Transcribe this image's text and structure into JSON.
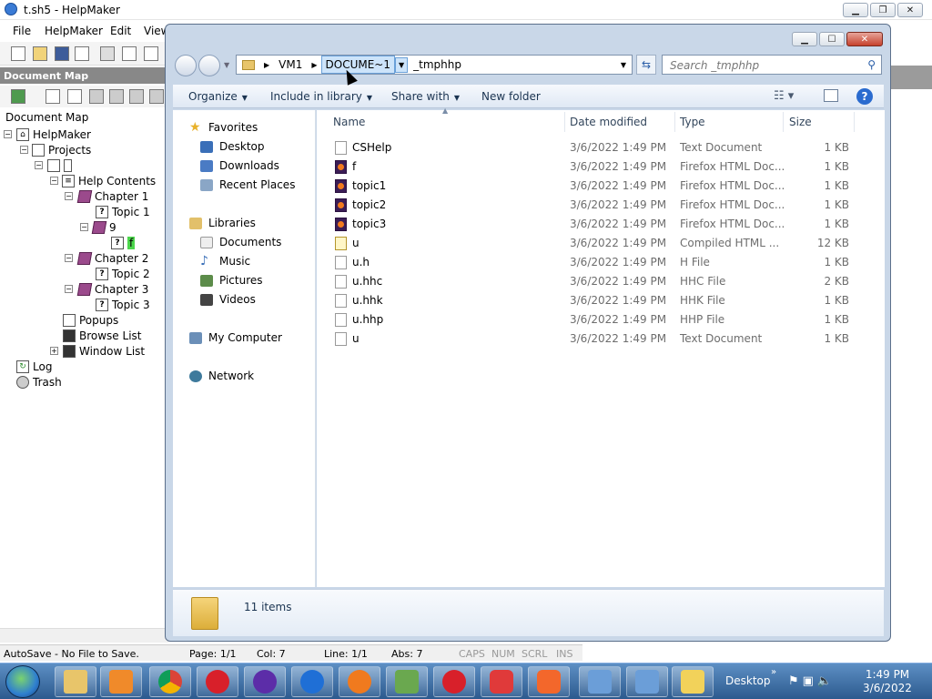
{
  "helpmaker": {
    "title": "t.sh5 - HelpMaker",
    "menu": [
      "File",
      "HelpMaker",
      "Edit",
      "View"
    ],
    "document_map_header": "Document Map",
    "document_map_label": "Document Map",
    "tree": {
      "root": "HelpMaker",
      "projects": "Projects",
      "help_contents": "Help Contents",
      "chapter1": "Chapter 1",
      "topic1": "Topic 1",
      "node9": "9",
      "node_f": "f",
      "chapter2": "Chapter 2",
      "topic2": "Topic 2",
      "chapter3": "Chapter 3",
      "topic3": "Topic 3",
      "popups": "Popups",
      "browse_list": "Browse List",
      "window_list": "Window List",
      "log": "Log",
      "trash": "Trash"
    },
    "status": {
      "autosave": "AutoSave - No File to Save.",
      "page": "Page: 1/1",
      "col": "Col: 7",
      "line": "Line: 1/1",
      "abs": "Abs: 7",
      "caps": "CAPS",
      "num": "NUM",
      "scrl": "SCRL",
      "ins": "INS"
    }
  },
  "explorer": {
    "address": {
      "crumbs": [
        "VM1",
        "DOCUME~1",
        "_tmphhp"
      ],
      "selected_crumb": "DOCUME~1"
    },
    "search_placeholder": "Search _tmphhp",
    "commands": {
      "organize": "Organize",
      "include_in_library": "Include in library",
      "share_with": "Share with",
      "new_folder": "New folder"
    },
    "nav": {
      "favorites": "Favorites",
      "desktop": "Desktop",
      "downloads": "Downloads",
      "recent_places": "Recent Places",
      "libraries": "Libraries",
      "documents": "Documents",
      "music": "Music",
      "pictures": "Pictures",
      "videos": "Videos",
      "my_computer": "My Computer",
      "network": "Network"
    },
    "columns": {
      "name": "Name",
      "date": "Date modified",
      "type": "Type",
      "size": "Size"
    },
    "files": [
      {
        "name": "CSHelp",
        "date": "3/6/2022 1:49 PM",
        "type": "Text Document",
        "size": "1 KB",
        "icon": "text"
      },
      {
        "name": "f",
        "date": "3/6/2022 1:49 PM",
        "type": "Firefox HTML Doc...",
        "size": "1 KB",
        "icon": "firefox"
      },
      {
        "name": "topic1",
        "date": "3/6/2022 1:49 PM",
        "type": "Firefox HTML Doc...",
        "size": "1 KB",
        "icon": "firefox"
      },
      {
        "name": "topic2",
        "date": "3/6/2022 1:49 PM",
        "type": "Firefox HTML Doc...",
        "size": "1 KB",
        "icon": "firefox"
      },
      {
        "name": "topic3",
        "date": "3/6/2022 1:49 PM",
        "type": "Firefox HTML Doc...",
        "size": "1 KB",
        "icon": "firefox"
      },
      {
        "name": "u",
        "date": "3/6/2022 1:49 PM",
        "type": "Compiled HTML ...",
        "size": "12 KB",
        "icon": "chm"
      },
      {
        "name": "u.h",
        "date": "3/6/2022 1:49 PM",
        "type": "H File",
        "size": "1 KB",
        "icon": "text"
      },
      {
        "name": "u.hhc",
        "date": "3/6/2022 1:49 PM",
        "type": "HHC File",
        "size": "2 KB",
        "icon": "text"
      },
      {
        "name": "u.hhk",
        "date": "3/6/2022 1:49 PM",
        "type": "HHK File",
        "size": "1 KB",
        "icon": "text"
      },
      {
        "name": "u.hhp",
        "date": "3/6/2022 1:49 PM",
        "type": "HHP File",
        "size": "1 KB",
        "icon": "text"
      },
      {
        "name": "u",
        "date": "3/6/2022 1:49 PM",
        "type": "Text Document",
        "size": "1 KB",
        "icon": "text"
      }
    ],
    "item_count": "11 items"
  },
  "taskbar": {
    "desktop_label": "Desktop",
    "time": "1:49 PM",
    "date": "3/6/2022"
  }
}
